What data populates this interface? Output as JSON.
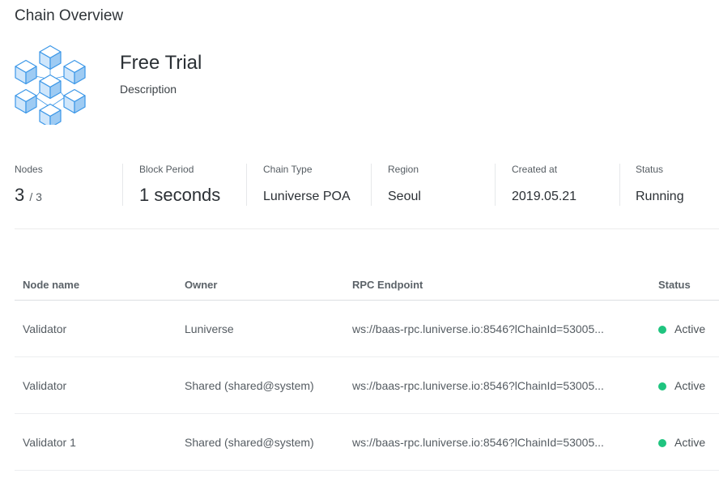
{
  "page_title": "Chain Overview",
  "chain": {
    "name": "Free Trial",
    "description": "Description",
    "logo_icon": "blockchain-cubes-icon"
  },
  "stats": {
    "nodes": {
      "label": "Nodes",
      "current": "3",
      "total": "/ 3"
    },
    "block_period": {
      "label": "Block Period",
      "value": "1 seconds"
    },
    "chain_type": {
      "label": "Chain Type",
      "value": "Luniverse POA"
    },
    "region": {
      "label": "Region",
      "value": "Seoul"
    },
    "created_at": {
      "label": "Created at",
      "value": "2019.05.21"
    },
    "status": {
      "label": "Status",
      "value": "Running"
    }
  },
  "nodes_table": {
    "headers": {
      "node_name": "Node name",
      "owner": "Owner",
      "rpc_endpoint": "RPC Endpoint",
      "status": "Status"
    },
    "rows": [
      {
        "node_name": "Validator",
        "owner": "Luniverse",
        "rpc_endpoint": "ws://baas-rpc.luniverse.io:8546?lChainId=53005...",
        "status": "Active"
      },
      {
        "node_name": "Validator",
        "owner": "Shared (shared@system)",
        "rpc_endpoint": "ws://baas-rpc.luniverse.io:8546?lChainId=53005...",
        "status": "Active"
      },
      {
        "node_name": "Validator 1",
        "owner": "Shared (shared@system)",
        "rpc_endpoint": "ws://baas-rpc.luniverse.io:8546?lChainId=53005...",
        "status": "Active"
      }
    ]
  },
  "colors": {
    "active_status": "#1fc47f",
    "logo_fill": "#cfe6fb",
    "logo_stroke": "#3b97e8"
  }
}
